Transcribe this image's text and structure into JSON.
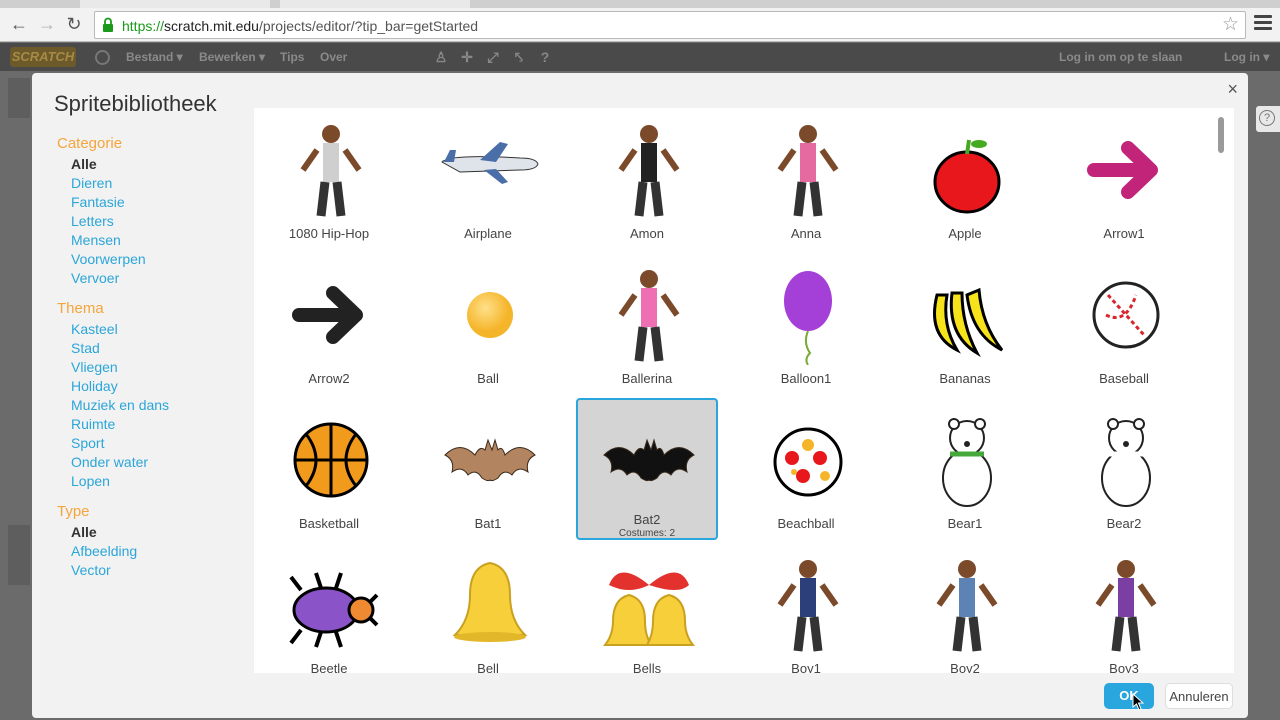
{
  "browser": {
    "url_scheme": "https://",
    "url_host": "scratch.mit.edu",
    "url_path": "/projects/editor/?tip_bar=getStarted"
  },
  "scratch_menu": {
    "logo": "SCRATCH",
    "file": "Bestand ▾",
    "edit": "Bewerken ▾",
    "tips": "Tips",
    "about": "Over",
    "login_to_save": "Log in om op te slaan",
    "login": "Log in ▾"
  },
  "dialog": {
    "title": "Spritebibliotheek",
    "close": "×",
    "ok_label": "OK",
    "cancel_label": "Annuleren"
  },
  "sidebar": {
    "category": {
      "heading": "Categorie",
      "items": [
        "Alle",
        "Dieren",
        "Fantasie",
        "Letters",
        "Mensen",
        "Voorwerpen",
        "Vervoer"
      ],
      "selected": "Alle"
    },
    "theme": {
      "heading": "Thema",
      "items": [
        "Kasteel",
        "Stad",
        "Vliegen",
        "Holiday",
        "Muziek en dans",
        "Ruimte",
        "Sport",
        "Onder water",
        "Lopen"
      ]
    },
    "type": {
      "heading": "Type",
      "items": [
        "Alle",
        "Afbeelding",
        "Vector"
      ],
      "selected": "Alle"
    }
  },
  "sprites": [
    {
      "name": "1080 Hip-Hop",
      "icon": "dancer-icon",
      "color": "#cfcfcf"
    },
    {
      "name": "Airplane",
      "icon": "airplane-icon",
      "color": "#4a6fa8"
    },
    {
      "name": "Amon",
      "icon": "dancer-icon",
      "color": "#222222"
    },
    {
      "name": "Anna",
      "icon": "girl-icon",
      "color": "#e56aa0"
    },
    {
      "name": "Apple",
      "icon": "apple-icon",
      "color": "#e8171c"
    },
    {
      "name": "Arrow1",
      "icon": "arrow-icon",
      "color": "#c2247a"
    },
    {
      "name": "Arrow2",
      "icon": "arrow-icon",
      "color": "#222222"
    },
    {
      "name": "Ball",
      "icon": "ball-icon",
      "color": "#f5b52a"
    },
    {
      "name": "Ballerina",
      "icon": "ballerina-icon",
      "color": "#ef6fb5"
    },
    {
      "name": "Balloon1",
      "icon": "balloon-icon",
      "color": "#a440d8"
    },
    {
      "name": "Bananas",
      "icon": "bananas-icon",
      "color": "#f6e31b"
    },
    {
      "name": "Baseball",
      "icon": "baseball-icon",
      "color": "#d8262c"
    },
    {
      "name": "Basketball",
      "icon": "basketball-icon",
      "color": "#f29a1b"
    },
    {
      "name": "Bat1",
      "icon": "bat-icon",
      "color": "#b28460"
    },
    {
      "name": "Bat2",
      "icon": "bat-icon",
      "color": "#111111",
      "sub": "Costumes: 2",
      "selected": true
    },
    {
      "name": "Beachball",
      "icon": "beachball-icon",
      "color": "#e8171c"
    },
    {
      "name": "Bear1",
      "icon": "bear-icon",
      "color": "#45a83b"
    },
    {
      "name": "Bear2",
      "icon": "bear-icon",
      "color": "#ffffff"
    },
    {
      "name": "Beetle",
      "icon": "beetle-icon",
      "color": "#8a54c8"
    },
    {
      "name": "Bell",
      "icon": "bell-icon",
      "color": "#f7cf3a"
    },
    {
      "name": "Bells",
      "icon": "bells-icon",
      "color": "#f7cf3a"
    },
    {
      "name": "Boy1",
      "icon": "boy-icon",
      "color": "#2c3f7b"
    },
    {
      "name": "Boy2",
      "icon": "boy-icon",
      "color": "#5d83b5"
    },
    {
      "name": "Boy3",
      "icon": "boy-icon",
      "color": "#7b3fa4"
    }
  ],
  "colors": {
    "accent": "#29a6de",
    "heading": "#f5a53b",
    "link": "#2ba6d9"
  }
}
